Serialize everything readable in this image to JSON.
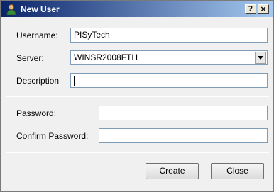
{
  "window": {
    "title": "New User",
    "help_glyph": "?",
    "close_glyph": "×"
  },
  "form": {
    "username": {
      "label": "Username:",
      "value": "PISyTech"
    },
    "server": {
      "label": "Server:",
      "value": "WINSR2008FTH"
    },
    "description": {
      "label": "Description",
      "value": ""
    },
    "password": {
      "label": "Password:",
      "value": ""
    },
    "confirm_password": {
      "label": "Confirm Password:",
      "value": ""
    }
  },
  "buttons": {
    "create": "Create",
    "close": "Close"
  },
  "icons": {
    "title_icon": "user-icon",
    "dropdown": "chevron-down-icon"
  }
}
